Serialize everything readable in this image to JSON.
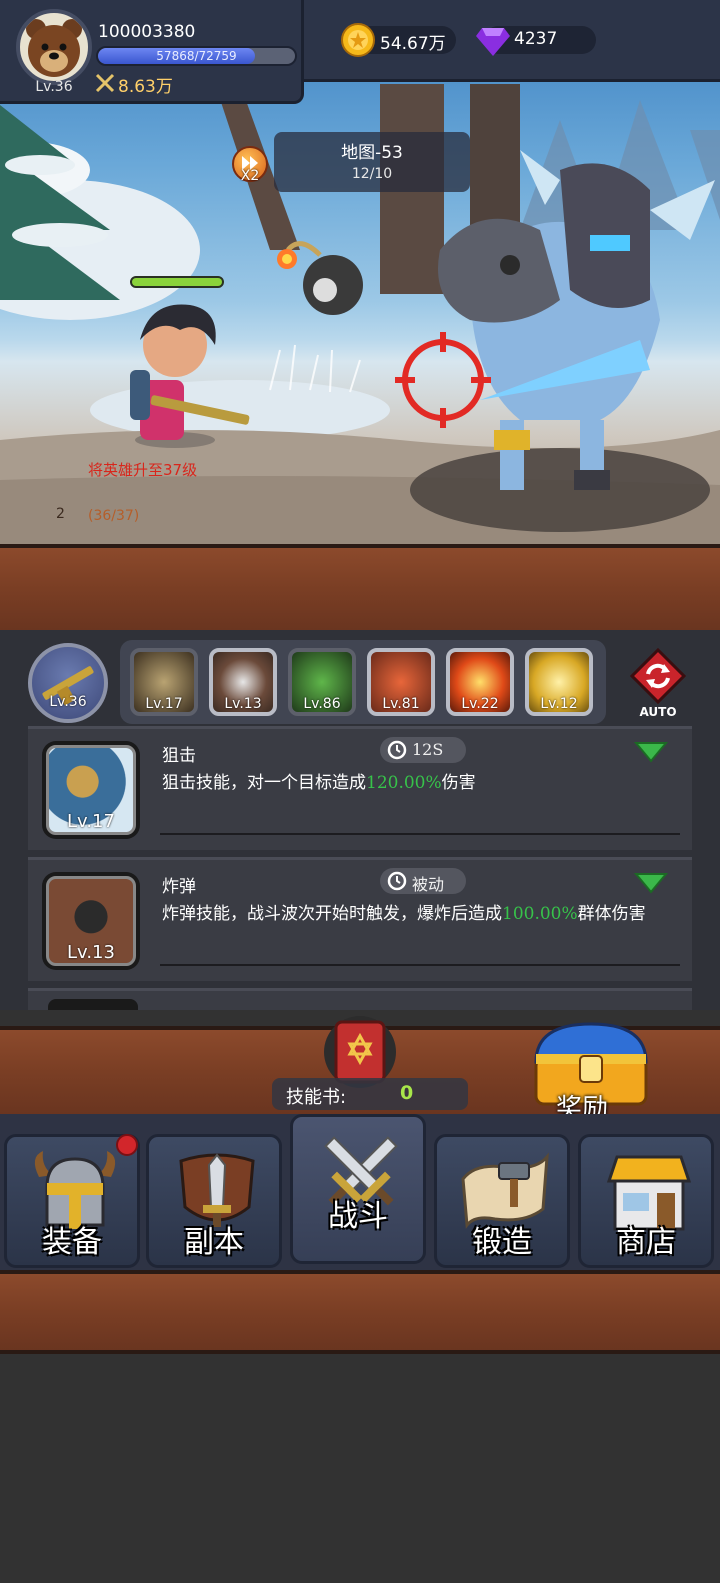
{
  "player": {
    "id": "100003380",
    "level": "Lv.36",
    "xp_text": "57868/72759",
    "xp_progress": 0.795,
    "power": "8.63万"
  },
  "currency": {
    "gold": "54.67万",
    "gems": "4237"
  },
  "stage": {
    "speed": "X2",
    "map_name": "地图-53",
    "wave": "12/10"
  },
  "quest": {
    "text": "将英雄升至37级",
    "progress": "(36/37)",
    "book_count": "2"
  },
  "skill_bar": {
    "weapon_level": "Lv.36",
    "slots": [
      {
        "name": "sniper",
        "level": "Lv.17"
      },
      {
        "name": "bomb",
        "level": "Lv.13"
      },
      {
        "name": "poison",
        "level": "Lv.86"
      },
      {
        "name": "explosion",
        "level": "Lv.81"
      },
      {
        "name": "fireball",
        "level": "Lv.22"
      },
      {
        "name": "lightning",
        "level": "Lv.12"
      }
    ],
    "auto_label": "AUTO"
  },
  "skills": [
    {
      "name": "狙击",
      "cooldown": "12S",
      "icon_level": "Lv.17",
      "desc_before": "狙击技能，对一个目标造成",
      "desc_value": "120.00%",
      "desc_after": "伤害"
    },
    {
      "name": "炸弹",
      "cooldown": "被动",
      "icon_level": "Lv.13",
      "desc_before": "炸弹技能，战斗波次开始时触发，爆炸后造成",
      "desc_value": "100.00%",
      "desc_after": "群体伤害"
    }
  ],
  "bottom": {
    "skill_book_label": "技能书:",
    "skill_book_count": "0",
    "reward_label": "奖励"
  },
  "nav": [
    {
      "label": "装备"
    },
    {
      "label": "副本"
    },
    {
      "label": "战斗"
    },
    {
      "label": "锻造"
    },
    {
      "label": "商店"
    }
  ],
  "colors": {
    "highlight_green": "#37c24a",
    "hp_green": "#8ad33b",
    "quest_red": "#d8261c",
    "wood": "#7a3e24"
  }
}
